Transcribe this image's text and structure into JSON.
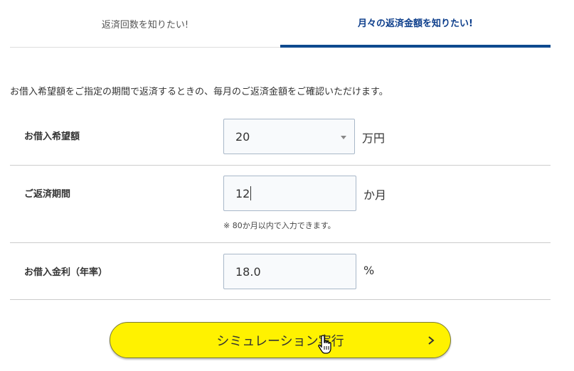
{
  "tabs": [
    {
      "label": "返済回数を知りたい!",
      "active": false
    },
    {
      "label": "月々の返済金額を知りたい!",
      "active": true
    }
  ],
  "intro": "お借入希望額をご指定の期間で返済するときの、毎月のご返済金額をご確認いただけます。",
  "form": {
    "amount": {
      "label": "お借入希望額",
      "value": "20",
      "unit": "万円"
    },
    "period": {
      "label": "ご返済期間",
      "value": "12",
      "unit": "か月",
      "note": "※ 80か月以内で入力できます。"
    },
    "rate": {
      "label": "お借入金利（年率）",
      "value": "18.0",
      "unit": "%"
    }
  },
  "button": {
    "label": "シミュレーション実行"
  },
  "colors": {
    "accent": "#0e4a8f",
    "button_bg": "#fff200"
  },
  "icons": {
    "select": "chevron-down-icon",
    "button": "chevron-right-icon",
    "cursor": "hand-pointer-icon"
  }
}
